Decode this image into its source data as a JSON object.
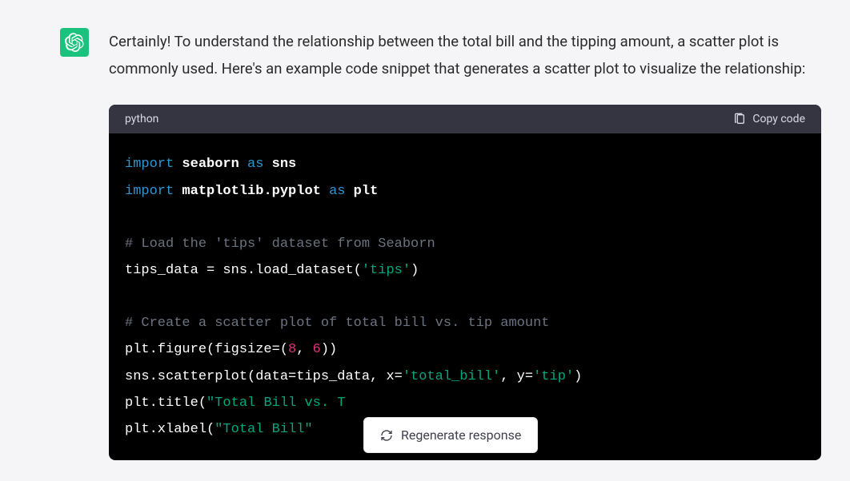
{
  "message": {
    "prose": "Certainly! To understand the relationship between the total bill and the tipping amount, a scatter plot is commonly used. Here's an example code snippet that generates a scatter plot to visualize the relationship:"
  },
  "code_block": {
    "language": "python",
    "copy_label": "Copy code",
    "lines": {
      "l1_kw": "import",
      "l1_mod": "seaborn",
      "l1_as": "as",
      "l1_alias": "sns",
      "l2_kw": "import",
      "l2_mod": "matplotlib.pyplot",
      "l2_as": "as",
      "l2_alias": "plt",
      "l4_comment": "# Load the 'tips' dataset from Seaborn",
      "l5_pre": "tips_data = sns.load_dataset(",
      "l5_str": "'tips'",
      "l5_post": ")",
      "l7_comment": "# Create a scatter plot of total bill vs. tip amount",
      "l8_pre": "plt.figure(figsize=(",
      "l8_n1": "8",
      "l8_mid": ", ",
      "l8_n2": "6",
      "l8_post": "))",
      "l9_pre": "sns.scatterplot(data=tips_data, x=",
      "l9_s1": "'total_bill'",
      "l9_mid": ", y=",
      "l9_s2": "'tip'",
      "l9_post": ")",
      "l10_pre": "plt.title(",
      "l10_str": "\"Total Bill vs. T",
      "l11_pre": "plt.xlabel(",
      "l11_str": "\"Total Bill\""
    }
  },
  "regenerate": {
    "label": "Regenerate response"
  }
}
